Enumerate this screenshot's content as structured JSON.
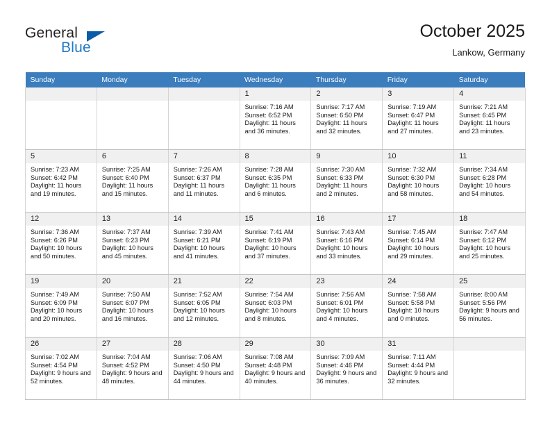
{
  "brand": {
    "word_one": "General",
    "word_two": "Blue",
    "logo_icon": "triangle-logo-icon",
    "accent_blue": "#2079c7",
    "triangle_blue": "#0a5ca8"
  },
  "header": {
    "title": "October 2025",
    "subtitle": "Lankow, Germany"
  },
  "calendar": {
    "header_bg": "#3b7dbd",
    "daynum_bg": "#f0f0f0",
    "weekday_headers": [
      "Sunday",
      "Monday",
      "Tuesday",
      "Wednesday",
      "Thursday",
      "Friday",
      "Saturday"
    ],
    "weeks": [
      [
        {
          "day": "",
          "empty": true,
          "sunrise": "",
          "sunset": "",
          "daylight": ""
        },
        {
          "day": "",
          "empty": true,
          "sunrise": "",
          "sunset": "",
          "daylight": ""
        },
        {
          "day": "",
          "empty": true,
          "sunrise": "",
          "sunset": "",
          "daylight": ""
        },
        {
          "day": "1",
          "sunrise": "Sunrise: 7:16 AM",
          "sunset": "Sunset: 6:52 PM",
          "daylight": "Daylight: 11 hours and 36 minutes."
        },
        {
          "day": "2",
          "sunrise": "Sunrise: 7:17 AM",
          "sunset": "Sunset: 6:50 PM",
          "daylight": "Daylight: 11 hours and 32 minutes."
        },
        {
          "day": "3",
          "sunrise": "Sunrise: 7:19 AM",
          "sunset": "Sunset: 6:47 PM",
          "daylight": "Daylight: 11 hours and 27 minutes."
        },
        {
          "day": "4",
          "sunrise": "Sunrise: 7:21 AM",
          "sunset": "Sunset: 6:45 PM",
          "daylight": "Daylight: 11 hours and 23 minutes."
        }
      ],
      [
        {
          "day": "5",
          "sunrise": "Sunrise: 7:23 AM",
          "sunset": "Sunset: 6:42 PM",
          "daylight": "Daylight: 11 hours and 19 minutes."
        },
        {
          "day": "6",
          "sunrise": "Sunrise: 7:25 AM",
          "sunset": "Sunset: 6:40 PM",
          "daylight": "Daylight: 11 hours and 15 minutes."
        },
        {
          "day": "7",
          "sunrise": "Sunrise: 7:26 AM",
          "sunset": "Sunset: 6:37 PM",
          "daylight": "Daylight: 11 hours and 11 minutes."
        },
        {
          "day": "8",
          "sunrise": "Sunrise: 7:28 AM",
          "sunset": "Sunset: 6:35 PM",
          "daylight": "Daylight: 11 hours and 6 minutes."
        },
        {
          "day": "9",
          "sunrise": "Sunrise: 7:30 AM",
          "sunset": "Sunset: 6:33 PM",
          "daylight": "Daylight: 11 hours and 2 minutes."
        },
        {
          "day": "10",
          "sunrise": "Sunrise: 7:32 AM",
          "sunset": "Sunset: 6:30 PM",
          "daylight": "Daylight: 10 hours and 58 minutes."
        },
        {
          "day": "11",
          "sunrise": "Sunrise: 7:34 AM",
          "sunset": "Sunset: 6:28 PM",
          "daylight": "Daylight: 10 hours and 54 minutes."
        }
      ],
      [
        {
          "day": "12",
          "sunrise": "Sunrise: 7:36 AM",
          "sunset": "Sunset: 6:26 PM",
          "daylight": "Daylight: 10 hours and 50 minutes."
        },
        {
          "day": "13",
          "sunrise": "Sunrise: 7:37 AM",
          "sunset": "Sunset: 6:23 PM",
          "daylight": "Daylight: 10 hours and 45 minutes."
        },
        {
          "day": "14",
          "sunrise": "Sunrise: 7:39 AM",
          "sunset": "Sunset: 6:21 PM",
          "daylight": "Daylight: 10 hours and 41 minutes."
        },
        {
          "day": "15",
          "sunrise": "Sunrise: 7:41 AM",
          "sunset": "Sunset: 6:19 PM",
          "daylight": "Daylight: 10 hours and 37 minutes."
        },
        {
          "day": "16",
          "sunrise": "Sunrise: 7:43 AM",
          "sunset": "Sunset: 6:16 PM",
          "daylight": "Daylight: 10 hours and 33 minutes."
        },
        {
          "day": "17",
          "sunrise": "Sunrise: 7:45 AM",
          "sunset": "Sunset: 6:14 PM",
          "daylight": "Daylight: 10 hours and 29 minutes."
        },
        {
          "day": "18",
          "sunrise": "Sunrise: 7:47 AM",
          "sunset": "Sunset: 6:12 PM",
          "daylight": "Daylight: 10 hours and 25 minutes."
        }
      ],
      [
        {
          "day": "19",
          "sunrise": "Sunrise: 7:49 AM",
          "sunset": "Sunset: 6:09 PM",
          "daylight": "Daylight: 10 hours and 20 minutes."
        },
        {
          "day": "20",
          "sunrise": "Sunrise: 7:50 AM",
          "sunset": "Sunset: 6:07 PM",
          "daylight": "Daylight: 10 hours and 16 minutes."
        },
        {
          "day": "21",
          "sunrise": "Sunrise: 7:52 AM",
          "sunset": "Sunset: 6:05 PM",
          "daylight": "Daylight: 10 hours and 12 minutes."
        },
        {
          "day": "22",
          "sunrise": "Sunrise: 7:54 AM",
          "sunset": "Sunset: 6:03 PM",
          "daylight": "Daylight: 10 hours and 8 minutes."
        },
        {
          "day": "23",
          "sunrise": "Sunrise: 7:56 AM",
          "sunset": "Sunset: 6:01 PM",
          "daylight": "Daylight: 10 hours and 4 minutes."
        },
        {
          "day": "24",
          "sunrise": "Sunrise: 7:58 AM",
          "sunset": "Sunset: 5:58 PM",
          "daylight": "Daylight: 10 hours and 0 minutes."
        },
        {
          "day": "25",
          "sunrise": "Sunrise: 8:00 AM",
          "sunset": "Sunset: 5:56 PM",
          "daylight": "Daylight: 9 hours and 56 minutes."
        }
      ],
      [
        {
          "day": "26",
          "sunrise": "Sunrise: 7:02 AM",
          "sunset": "Sunset: 4:54 PM",
          "daylight": "Daylight: 9 hours and 52 minutes."
        },
        {
          "day": "27",
          "sunrise": "Sunrise: 7:04 AM",
          "sunset": "Sunset: 4:52 PM",
          "daylight": "Daylight: 9 hours and 48 minutes."
        },
        {
          "day": "28",
          "sunrise": "Sunrise: 7:06 AM",
          "sunset": "Sunset: 4:50 PM",
          "daylight": "Daylight: 9 hours and 44 minutes."
        },
        {
          "day": "29",
          "sunrise": "Sunrise: 7:08 AM",
          "sunset": "Sunset: 4:48 PM",
          "daylight": "Daylight: 9 hours and 40 minutes."
        },
        {
          "day": "30",
          "sunrise": "Sunrise: 7:09 AM",
          "sunset": "Sunset: 4:46 PM",
          "daylight": "Daylight: 9 hours and 36 minutes."
        },
        {
          "day": "31",
          "sunrise": "Sunrise: 7:11 AM",
          "sunset": "Sunset: 4:44 PM",
          "daylight": "Daylight: 9 hours and 32 minutes."
        },
        {
          "day": "",
          "empty": true,
          "sunrise": "",
          "sunset": "",
          "daylight": ""
        }
      ]
    ]
  }
}
